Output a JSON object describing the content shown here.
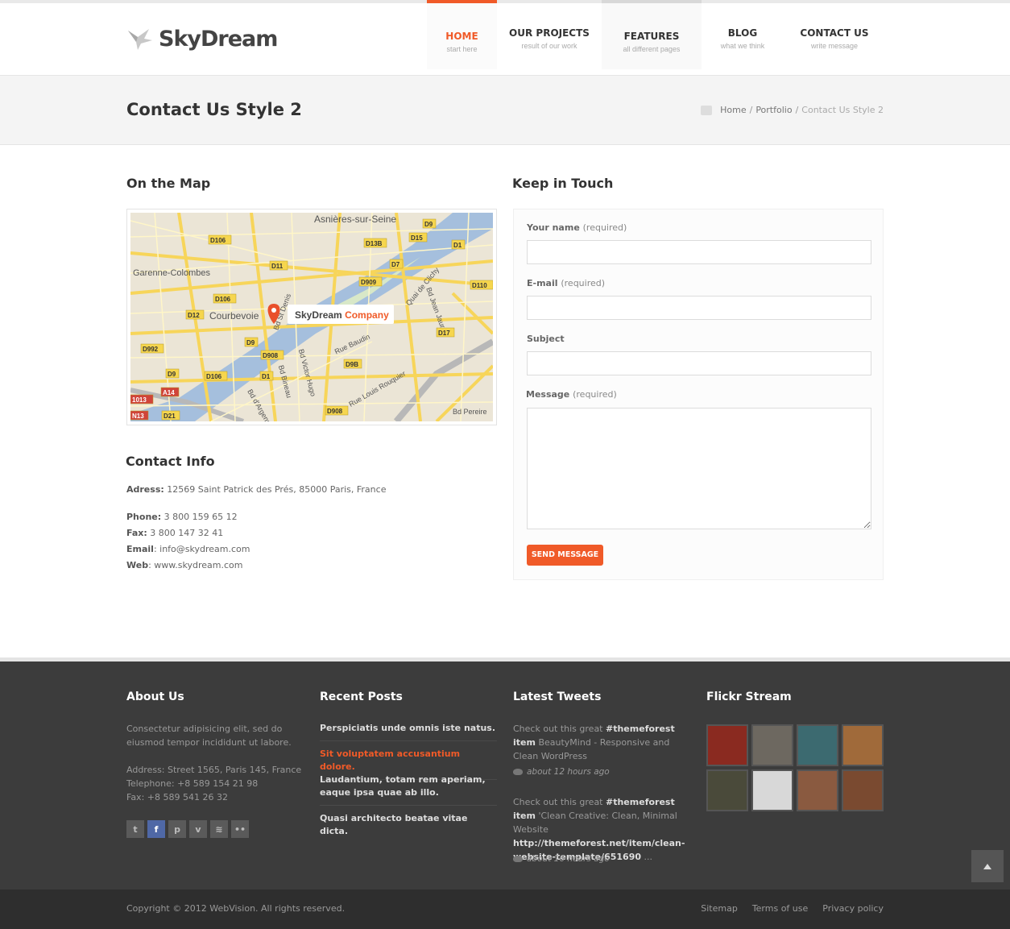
{
  "brand": {
    "name": "SkyDream"
  },
  "nav": [
    {
      "label": "HOME",
      "sub": "start here"
    },
    {
      "label": "OUR PROJECTS",
      "sub": "result of our work"
    },
    {
      "label": "FEATURES",
      "sub": "all different pages"
    },
    {
      "label": "BLOG",
      "sub": "what we think"
    },
    {
      "label": "CONTACT US",
      "sub": "write message"
    }
  ],
  "page": {
    "title": "Contact Us Style 2",
    "breadcrumb": [
      "Home",
      "Portfolio",
      "Contact Us Style 2"
    ]
  },
  "map": {
    "heading": "On the Map",
    "marker_label_brand": "SkyDream",
    "marker_label_suffix": "Company",
    "places": [
      "Asnières-sur-Seine",
      "Garenne-Colombes",
      "Courbevoie",
      "Quai de Clichy",
      "Bd Jean Jaurès",
      "Rue Baudin",
      "Rue Louis Rouquier",
      "Bd Victor Hugo",
      "Bd Bineau",
      "Bd d'Argenson",
      "Bd Pereire",
      "Bd St Denis"
    ],
    "road_labels": [
      "D9",
      "D106",
      "D13B",
      "D15",
      "D1",
      "D11",
      "D7",
      "D909",
      "D110",
      "D106",
      "D12",
      "D9",
      "D908",
      "D17",
      "D9B",
      "D992",
      "D9",
      "D106",
      "D1",
      "A14",
      "D908",
      "D21",
      "1013",
      "N13"
    ]
  },
  "contact_info": {
    "heading": "Contact Info",
    "address_label": "Adress:",
    "address": "12569 Saint Patrick des Prés, 85000 Paris, France",
    "phone_label": "Phone:",
    "phone": "3 800 159 65 12",
    "fax_label": "Fax:",
    "fax": "3 800 147 32 41",
    "email_label": "Email",
    "email": "info@skydream.com",
    "web_label": "Web",
    "web": "www.skydream.com"
  },
  "form": {
    "heading": "Keep in Touch",
    "name_label": "Your name",
    "email_label": "E-mail",
    "subject_label": "Subject",
    "message_label": "Message",
    "required": "(required)",
    "name_value": "",
    "email_value": "",
    "subject_value": "",
    "message_value": "",
    "send_label": "SEND MESSAGE"
  },
  "footer": {
    "about": {
      "heading": "About Us",
      "text": "Consectetur adipisicing elit, sed do eiusmod tempor incididunt ut labore.",
      "address": "Address: Street 1565, Paris 145, France",
      "telephone": "Telephone: +8 589 154 21 98",
      "fax": "Fax: +8 589 541 26 32",
      "social": [
        "twitter-icon",
        "facebook-icon",
        "pinterest-icon",
        "vimeo-icon",
        "rss-icon",
        "flickr-icon"
      ]
    },
    "posts": {
      "heading": "Recent Posts",
      "items": [
        "Perspiciatis unde omnis iste natus.",
        "Sit voluptatem accusantium dolore.",
        "Laudantium, totam rem aperiam, eaque ipsa quae ab illo.",
        "Quasi architecto beatae vitae dicta."
      ]
    },
    "tweets": {
      "heading": "Latest Tweets",
      "items": [
        {
          "prefix": "Check out this great ",
          "tag": "#themeforest item",
          "text": " BeautyMind - Responsive and Clean WordPress",
          "link": "",
          "time": "about 12 hours ago"
        },
        {
          "prefix": "Check out this great ",
          "tag": "#themeforest item",
          "text": " 'Clean Creative: Clean, Minimal Website ",
          "link": "http://themeforest.net/item/clean-website-template/651690",
          "suffix": " ...",
          "time": "about 16 hours ago"
        }
      ]
    },
    "flickr": {
      "heading": "Flickr Stream",
      "photos": [
        "#8a2a20",
        "#6d6860",
        "#3c6a70",
        "#a06a3a",
        "#4a4a3a",
        "#d8d8d8",
        "#8a5a40",
        "#7a4a30"
      ]
    },
    "copyright": "Copyright © 2012 WebVision. All rights reserved.",
    "links": [
      "Sitemap",
      "Terms of use",
      "Privacy policy"
    ]
  },
  "colors": {
    "accent": "#f05a28",
    "footer_bg": "#3c3c3c",
    "bottom_bg": "#2e2e2e"
  }
}
